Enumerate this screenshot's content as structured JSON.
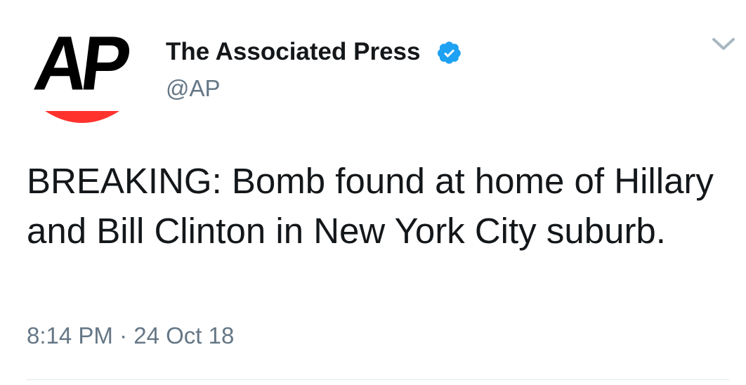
{
  "account": {
    "display_name": "The Associated Press",
    "handle": "@AP",
    "avatar_letters": "AP",
    "verified": true
  },
  "tweet": {
    "text": "BREAKING: Bomb found at home of Hillary and Bill Clinton in New York City suburb.",
    "time": "8:14 PM",
    "separator": "·",
    "date": "24 Oct 18"
  },
  "icons": {
    "verified": "verified-badge-icon",
    "menu": "chevron-down-icon"
  },
  "colors": {
    "logo_black": "#000000",
    "logo_red": "#ff322e",
    "verified_blue": "#1da1f2",
    "text_primary": "#14171a",
    "text_secondary": "#657786",
    "caret_gray": "#aab8c2"
  }
}
